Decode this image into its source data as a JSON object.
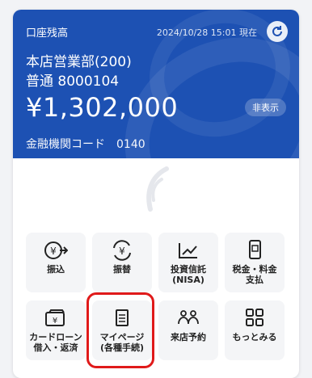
{
  "account": {
    "label": "口座残高",
    "updated": "2024/10/28 15:01 現在",
    "branch": "本店営業部(200)",
    "account_number": "普通 8000104",
    "balance": "¥1,302,000",
    "hide_label": "非表示",
    "bank_code": "金融機関コード　0140"
  },
  "menu": {
    "items": [
      {
        "label": "振込",
        "icon": "yen-transfer-icon"
      },
      {
        "label": "振替",
        "icon": "yen-exchange-icon"
      },
      {
        "label": "投資信託\n(NISA)",
        "icon": "chart-up-icon"
      },
      {
        "label": "税金・料金\n支払",
        "icon": "phone-pay-icon"
      },
      {
        "label": "カードローン\n借入・返済",
        "icon": "card-loan-icon"
      },
      {
        "label": "マイページ\n(各種手続)",
        "icon": "document-icon"
      },
      {
        "label": "来店予約",
        "icon": "people-icon"
      },
      {
        "label": "もっとみる",
        "icon": "grid-more-icon"
      }
    ]
  },
  "colors": {
    "brand": "#1d51b3",
    "highlight": "#e01a1a"
  }
}
